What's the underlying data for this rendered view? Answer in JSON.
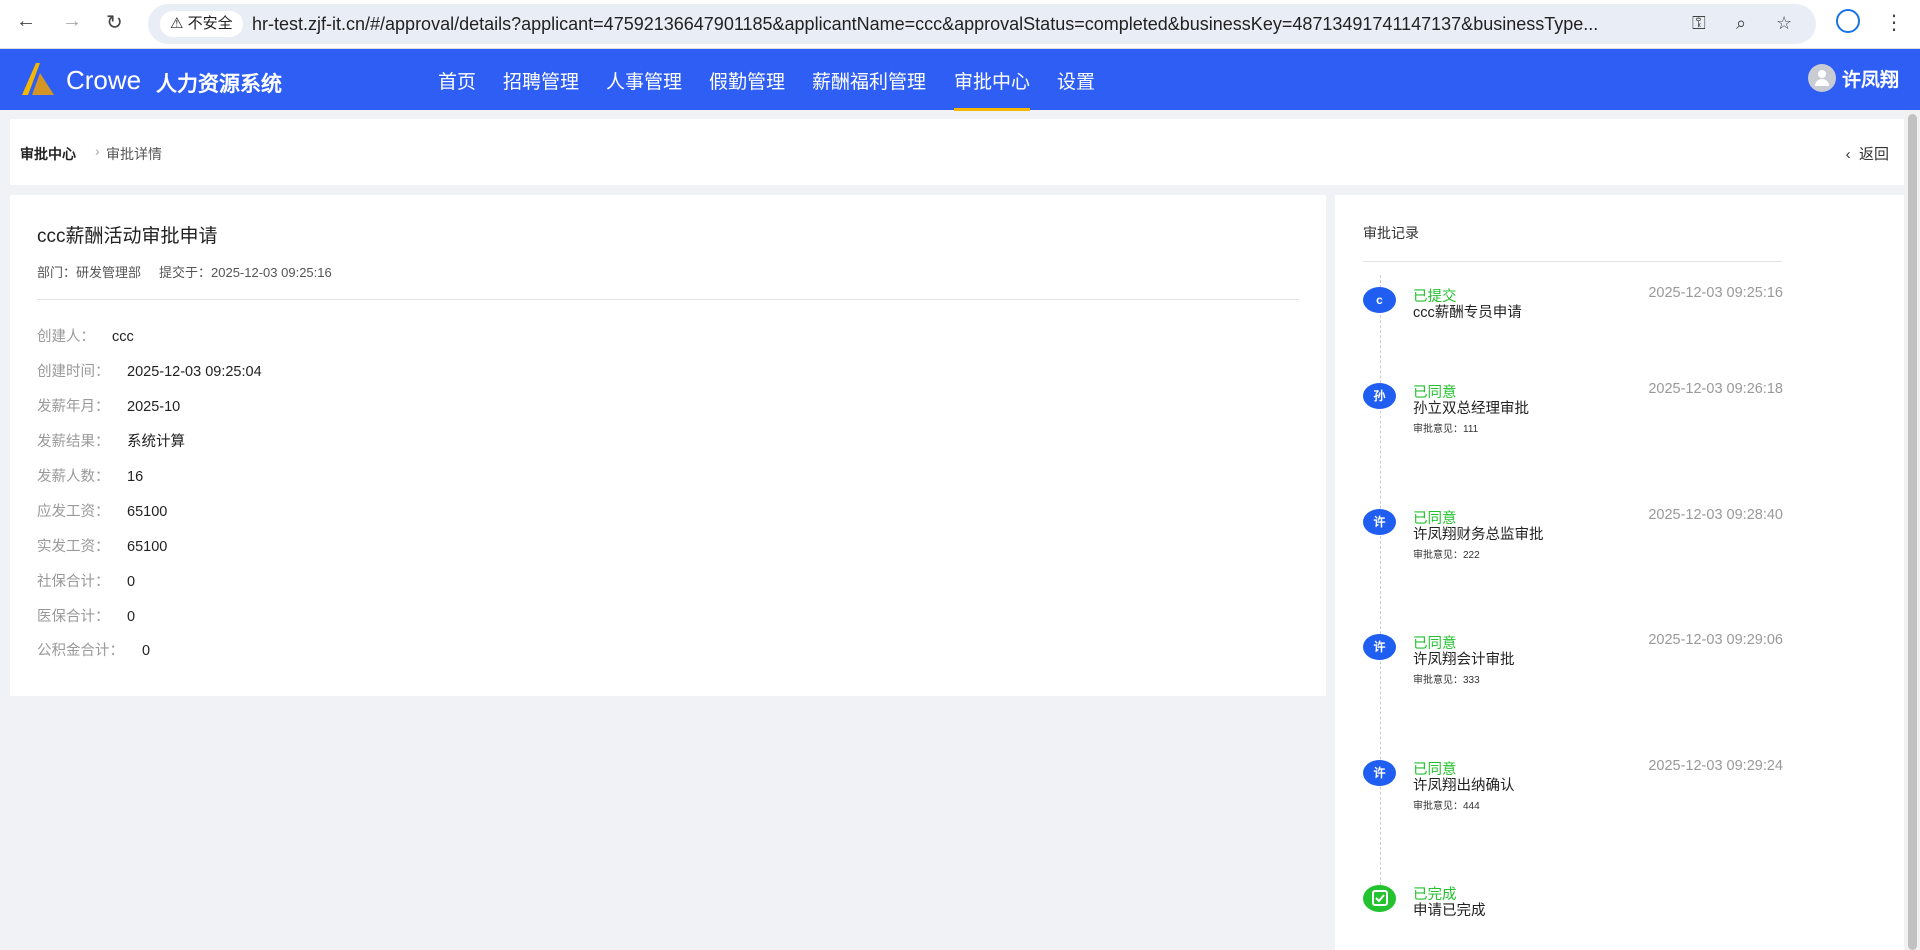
{
  "browser": {
    "security": "不安全",
    "url": "hr-test.zjf-it.cn/#/approval/details?applicant=47592136647901185&applicantName=ccc&approvalStatus=completed&businessKey=48713491741147137&businessType..."
  },
  "app": {
    "brand": "Crowe",
    "brand_cn": "人力资源系统",
    "user": "许凤翔",
    "accent": "#2f5ef5"
  },
  "nav": [
    {
      "label": "首页"
    },
    {
      "label": "招聘管理"
    },
    {
      "label": "人事管理"
    },
    {
      "label": "假勤管理"
    },
    {
      "label": "薪酬福利管理"
    },
    {
      "label": "审批中心",
      "active": true
    },
    {
      "label": "设置"
    }
  ],
  "breadcrumb": {
    "parent": "审批中心",
    "current": "审批详情",
    "back": "返回"
  },
  "detail": {
    "title": "ccc薪酬活动审批申请",
    "dept": "部门：研发管理部",
    "submitted": "提交于：2025-12-03 09:25:16",
    "fields": [
      {
        "label": "创建人：",
        "value": "ccc"
      },
      {
        "label": "创建时间：",
        "value": "2025-12-03 09:25:04"
      },
      {
        "label": "发薪年月：",
        "value": "2025-10"
      },
      {
        "label": "发薪结果：",
        "value": "系统计算"
      },
      {
        "label": "发薪人数：",
        "value": "16"
      },
      {
        "label": "应发工资：",
        "value": "65100"
      },
      {
        "label": "实发工资：",
        "value": "65100"
      },
      {
        "label": "社保合计：",
        "value": "0"
      },
      {
        "label": "医保合计：",
        "value": "0"
      },
      {
        "label": "公积金合计：",
        "value": "0"
      }
    ]
  },
  "records": {
    "title": "审批记录",
    "items": [
      {
        "avatar": "c",
        "status": "已提交",
        "time": "2025-12-03 09:25:16",
        "desc": "ccc薪酬专员申请"
      },
      {
        "avatar": "孙",
        "status": "已同意",
        "time": "2025-12-03 09:26:18",
        "desc": "孙立双总经理审批",
        "opinion": "审批意见：111"
      },
      {
        "avatar": "许",
        "status": "已同意",
        "time": "2025-12-03 09:28:40",
        "desc": "许凤翔财务总监审批",
        "opinion": "审批意见：222"
      },
      {
        "avatar": "许",
        "status": "已同意",
        "time": "2025-12-03 09:29:06",
        "desc": "许凤翔会计审批",
        "opinion": "审批意见：333"
      },
      {
        "avatar": "许",
        "status": "已同意",
        "time": "2025-12-03 09:29:24",
        "desc": "许凤翔出纳确认",
        "opinion": "审批意见：444"
      },
      {
        "status": "已完成",
        "desc": "申请已完成"
      }
    ]
  }
}
